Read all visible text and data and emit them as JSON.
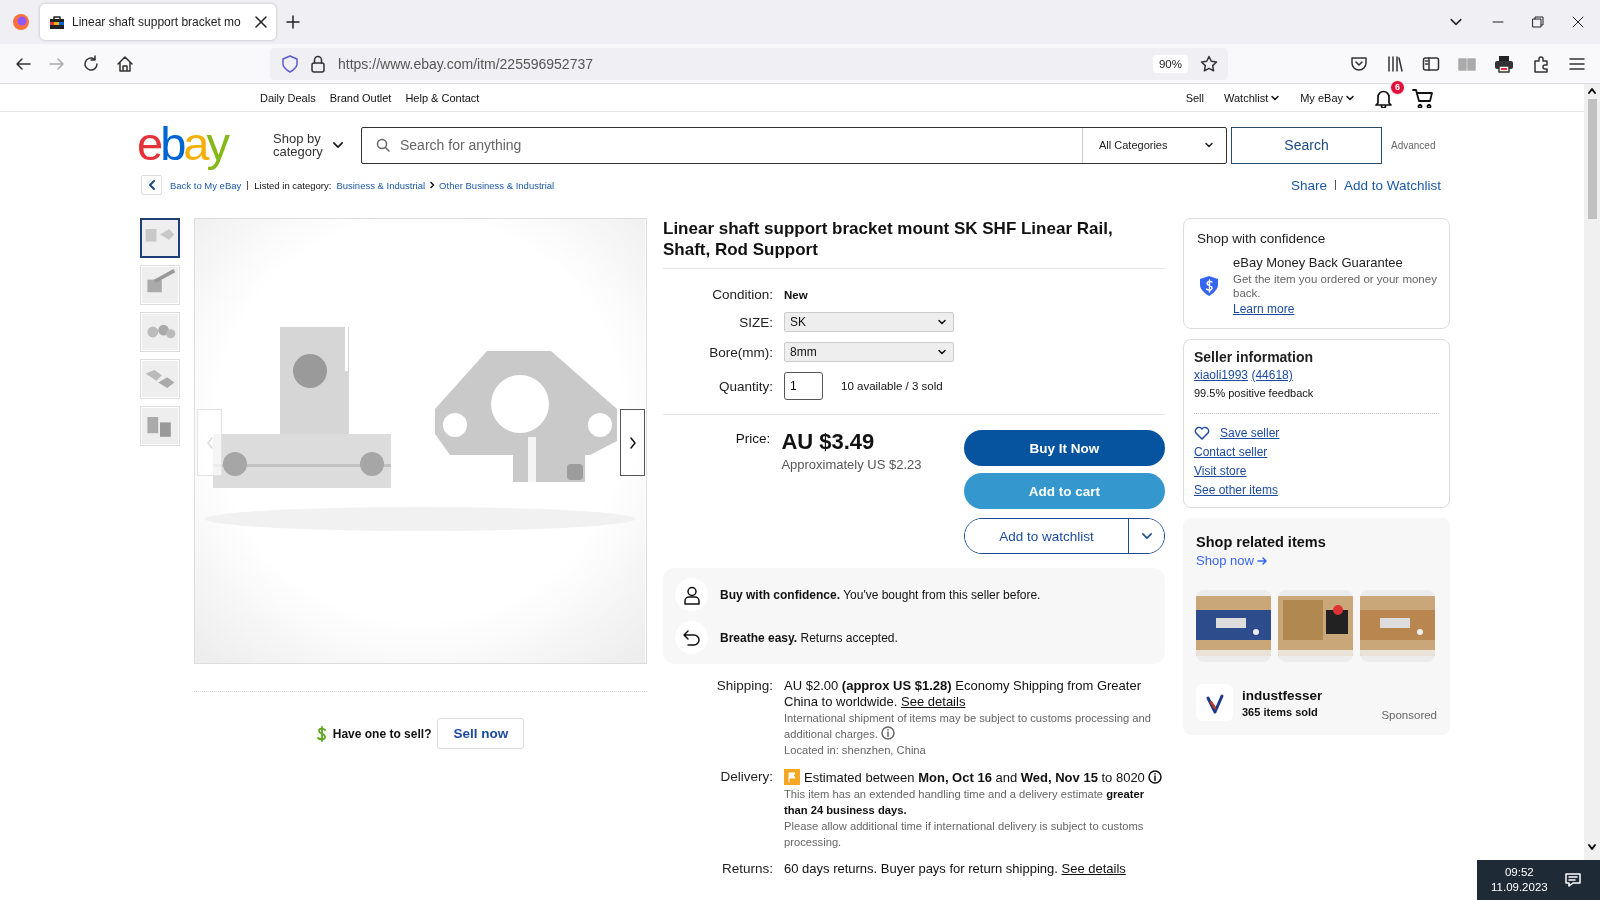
{
  "browser": {
    "tab_title": "Linear shaft support bracket mo",
    "url": "https://www.ebay.com/itm/225596952737",
    "zoom": "90%"
  },
  "top_nav": {
    "left": [
      "Daily Deals",
      "Brand Outlet",
      "Help & Contact"
    ],
    "right": [
      {
        "label": "Sell",
        "dropdown": false
      },
      {
        "label": "Watchlist",
        "dropdown": true
      },
      {
        "label": "My eBay",
        "dropdown": true
      }
    ],
    "notifications": "6"
  },
  "header": {
    "logo": "ebay",
    "shop_by": "Shop by category",
    "search_placeholder": "Search for anything",
    "category": "All Categories",
    "search_button": "Search",
    "advanced": "Advanced"
  },
  "breadcrumb": {
    "back": "Back to My eBay",
    "listed": "Listed in category:",
    "items": [
      "Business & Industrial",
      "Other Business & Industrial"
    ],
    "actions": [
      "Share",
      "Add to Watchlist"
    ]
  },
  "gallery": {
    "thumbnails": [
      {
        "selected": true
      },
      {
        "selected": false
      },
      {
        "selected": false
      },
      {
        "selected": false
      },
      {
        "selected": false
      }
    ],
    "sell_prompt": "Have one to sell?",
    "sell_button": "Sell now"
  },
  "item": {
    "title": "Linear shaft support bracket mount SK SHF Linear Rail, Shaft, Rod Support",
    "condition_label": "Condition:",
    "condition": "New",
    "options": [
      {
        "label": "SIZE:",
        "value": "SK"
      },
      {
        "label": "Bore(mm):",
        "value": "8mm"
      }
    ],
    "quantity_label": "Quantity:",
    "quantity": "1",
    "availability": "10 available / 3 sold",
    "price_label": "Price:",
    "price": "AU $3.49",
    "approx": "Approximately US $2.23",
    "buttons": [
      {
        "label": "Buy It Now",
        "kind": "primary"
      },
      {
        "label": "Add to cart",
        "kind": "secondary"
      },
      {
        "label": "Add to watchlist",
        "kind": "outline"
      }
    ],
    "assurances": [
      {
        "kind": "person",
        "text": "**Buy with confidence.** You've bought from this seller before."
      },
      {
        "kind": "return",
        "text": "**Breathe easy.** Returns accepted."
      }
    ]
  },
  "details": [
    {
      "label": "Shipping:",
      "text": "AU $2.00 **(approx US $1.28)** Economy Shipping from Greater China to worldwide.",
      "link": "See details",
      "flag": false,
      "info": false,
      "notes": [
        {
          "text": "International shipment of items may be subject to customs processing and additional charges.",
          "info": true
        },
        {
          "text": "Located in: shenzhen, China",
          "info": false
        }
      ]
    },
    {
      "label": "Delivery:",
      "text": "Estimated between **Mon, Oct 16** and **Wed, Nov 15** to 8020",
      "flag": true,
      "info": true,
      "notes": [
        {
          "text": "This item has an extended handling time and a delivery estimate **greater than 24 business days.**",
          "info": false
        },
        {
          "text": "Please allow additional time if international delivery is subject to customs processing.",
          "info": false
        }
      ]
    },
    {
      "label": "Returns:",
      "text": "60 days returns. Buyer pays for return shipping.",
      "link": "See details",
      "flag": false,
      "info": false
    }
  ],
  "confidence": {
    "title": "Shop with confidence",
    "heading": "eBay Money Back Guarantee",
    "text": "Get the item you ordered or your money back.",
    "link": "Learn more"
  },
  "seller": {
    "title": "Seller information",
    "name": "xiaoli1993",
    "score": "(44618)",
    "feedback": "99.5% positive feedback",
    "links": [
      {
        "label": "Save seller",
        "kind": "heart"
      },
      {
        "label": "Contact seller",
        "kind": "plain"
      },
      {
        "label": "Visit store",
        "kind": "plain"
      },
      {
        "label": "See other items",
        "kind": "plain"
      }
    ]
  },
  "related": {
    "title": "Shop related items",
    "link": "Shop now",
    "store": "industfesser",
    "sold": "365 items sold",
    "sponsored": "Sponsored"
  },
  "taskbar": {
    "time": "09:52",
    "date": "11.09.2023"
  }
}
